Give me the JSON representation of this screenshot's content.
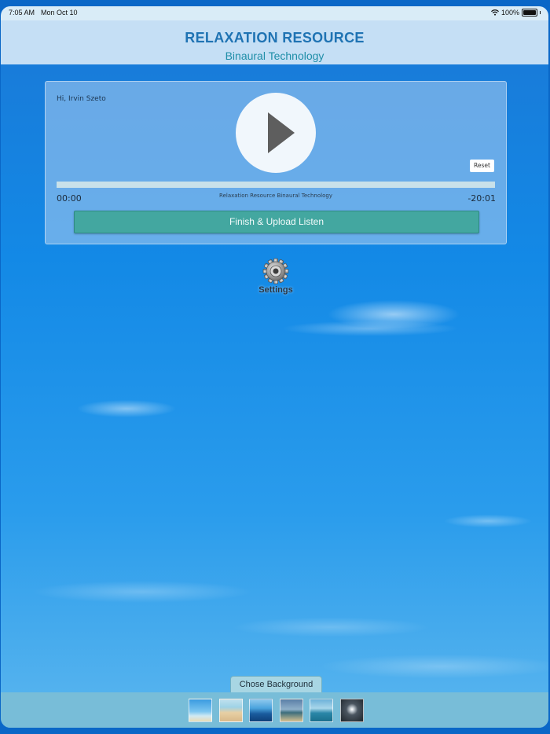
{
  "status_bar": {
    "time": "7:05 AM",
    "date": "Mon Oct 10",
    "battery": "100%"
  },
  "header": {
    "title": "RELAXATION RESOURCE",
    "subtitle": "Binaural Technology"
  },
  "player": {
    "greeting": "Hi, Irvin Szeto",
    "reset_label": "Reset",
    "progress": 0,
    "elapsed": "00:00",
    "remaining": "-20:01",
    "track_title": "Relaxation Resource Binaural Technology",
    "upload_label": "Finish & Upload Listen"
  },
  "settings": {
    "label": "Settings"
  },
  "background_picker": {
    "tab_label": "Chose Background",
    "thumbnails": [
      "beach-sky",
      "sandy-beach",
      "ocean-horizon",
      "palm-beach",
      "pier-sea",
      "moonlit-sky"
    ]
  },
  "colors": {
    "header_bg": "#c5dff5",
    "title": "#1f73b3",
    "subtitle": "#1f8ea8",
    "upload_button": "#43a7a0",
    "bottom_bar": "#78bdd8"
  }
}
